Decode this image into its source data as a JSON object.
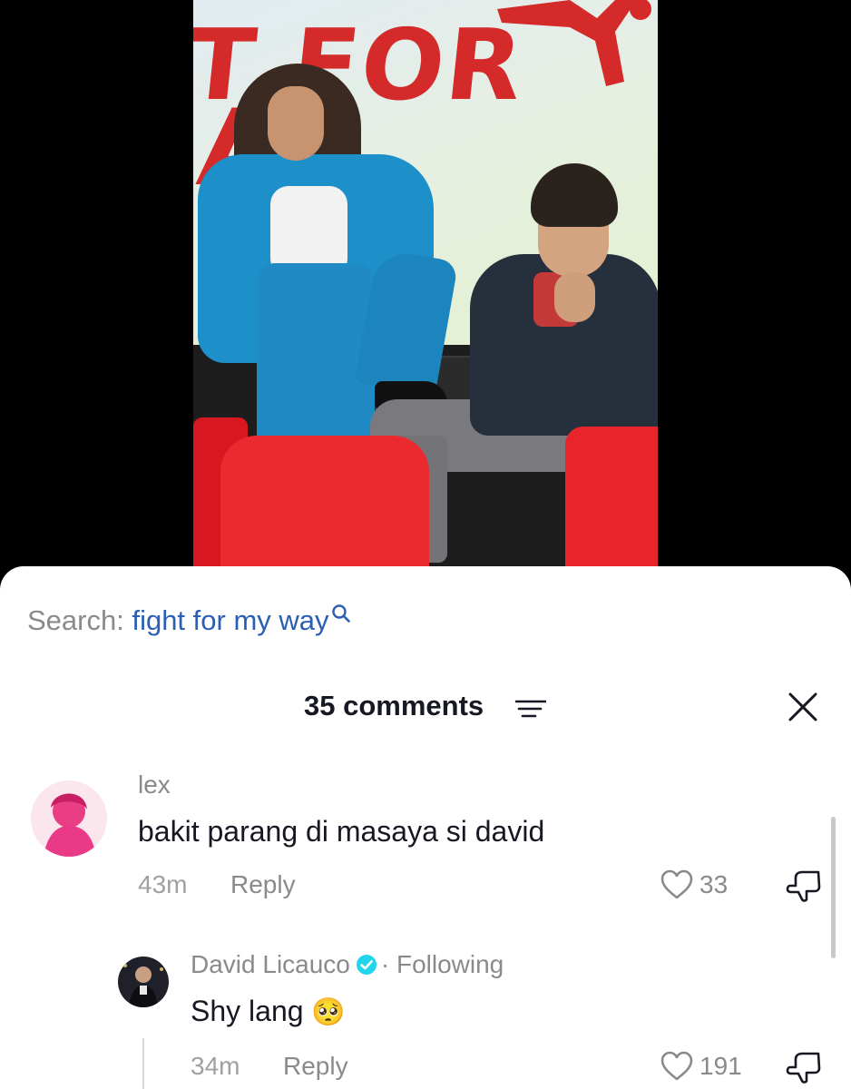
{
  "video": {
    "poster_line1": "T FOR",
    "poster_line2": "AY"
  },
  "search": {
    "label": "Search: ",
    "term": "fight for my way"
  },
  "comments_header": {
    "count_label": "35 comments"
  },
  "comments": [
    {
      "username": "lex",
      "text": "bakit parang di masaya si david",
      "time": "43m",
      "reply_label": "Reply",
      "likes": "33"
    }
  ],
  "replies": [
    {
      "username": "David Licauco",
      "following_label": "· Following",
      "text": "Shy lang",
      "emoji": "🥺",
      "time": "34m",
      "reply_label": "Reply",
      "likes": "191"
    }
  ],
  "colors": {
    "search_term": "#2b5fb3",
    "verified": "#20d5ec",
    "text_primary": "#161823",
    "text_secondary": "#8a8a8e"
  }
}
